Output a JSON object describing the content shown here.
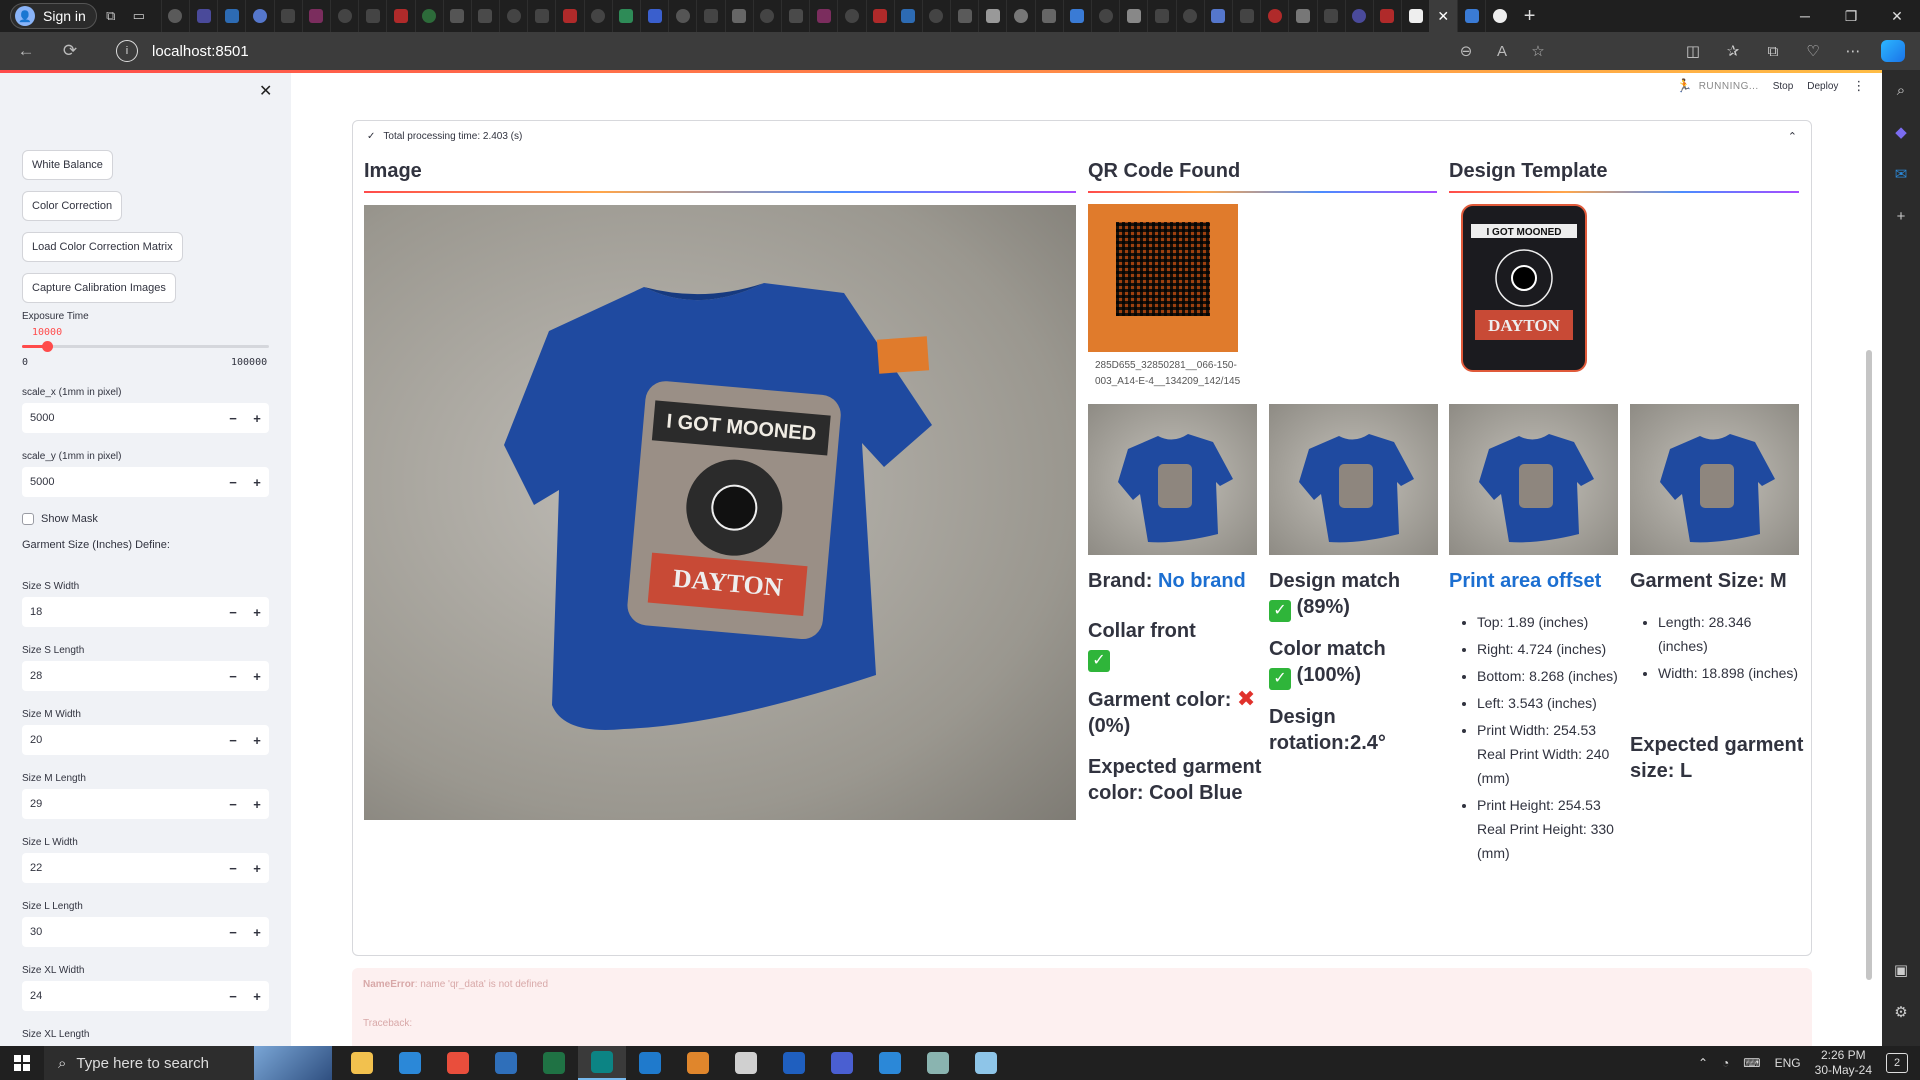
{
  "browser": {
    "signin_label": "Sign in",
    "url": "localhost:8501",
    "tab_colors": [
      "#5a5a5a",
      "#4a4a9a",
      "#2d6bb3",
      "#5577cc",
      "#444",
      "#7b2d5e",
      "#444",
      "#444",
      "#b02a2a",
      "#2d6b3a",
      "#555",
      "#4a4a4a",
      "#444",
      "#444",
      "#b02a2a",
      "#444",
      "#2e8b57",
      "#3a5fcd",
      "#555",
      "#444",
      "#666",
      "#444",
      "#4a4a4a",
      "#7b2d5e",
      "#444",
      "#b02a2a",
      "#2d6bb3",
      "#444",
      "#5a5a5a",
      "#999",
      "#777",
      "#666",
      "#3a7bd5",
      "#444",
      "#888",
      "#444",
      "#444",
      "#5577cc",
      "#444",
      "#b02a2a",
      "#777",
      "#444",
      "#4a4a9a",
      "#b02a2a",
      "#eee",
      "#eee",
      "#5c9f3d",
      "#eee",
      "#3a7bd5"
    ]
  },
  "header": {
    "running_label": "RUNNING...",
    "stop_label": "Stop",
    "deploy_label": "Deploy"
  },
  "sidebar": {
    "buttons": [
      "White Balance",
      "Color Correction",
      "Load Color Correction Matrix",
      "Capture Calibration Images"
    ],
    "exposure": {
      "label": "Exposure Time",
      "value": "10000",
      "min": "0",
      "max": "100000",
      "fraction": 0.1
    },
    "scale_x": {
      "label": "scale_x (1mm in pixel)",
      "value": "5000"
    },
    "scale_y": {
      "label": "scale_y (1mm in pixel)",
      "value": "5000"
    },
    "show_mask_label": "Show Mask",
    "garment_size_heading": "Garment Size (Inches) Define:",
    "sizes": [
      {
        "label": "Size S Width",
        "value": "18"
      },
      {
        "label": "Size S Length",
        "value": "28"
      },
      {
        "label": "Size M Width",
        "value": "20"
      },
      {
        "label": "Size M Length",
        "value": "29"
      },
      {
        "label": "Size L Width",
        "value": "22"
      },
      {
        "label": "Size L Length",
        "value": "30"
      },
      {
        "label": "Size XL Width",
        "value": "24"
      },
      {
        "label": "Size XL Length",
        "value": ""
      }
    ],
    "minus": "−",
    "plus": "+"
  },
  "expander": {
    "title": "Total processing time: 2.403 (s)",
    "col_image": "Image",
    "col_qr": "QR Code Found",
    "col_template": "Design Template",
    "qr_caption": "285D655_32850281__066-150-003_A14-E-4__134209_142/145"
  },
  "results": {
    "brand_label": "Brand: ",
    "brand_value": "No brand",
    "collar_label": "Collar front",
    "garment_color_label": "Garment color:",
    "garment_color_pct": "(0%)",
    "expected_color": "Expected garment color: Cool Blue",
    "design_match_label": "Design match",
    "design_match_pct": "(89%)",
    "color_match_label": "Color match",
    "color_match_pct": "(100%)",
    "design_rotation": "Design rotation:2.4°",
    "print_area_title": "Print area offset",
    "offsets": [
      "Top: 1.89 (inches)",
      "Right: 4.724 (inches)",
      "Bottom: 8.268 (inches)",
      "Left: 3.543 (inches)",
      "Print Width: 254.53 Real Print Width: 240 (mm)",
      "Print Height: 254.53 Real Print Height: 330 (mm)"
    ],
    "garment_size_title": "Garment Size: M",
    "garment_dims": [
      "Length: 28.346 (inches)",
      "Width: 18.898 (inches)"
    ],
    "expected_size": "Expected garment size: L"
  },
  "error": {
    "type": "NameError",
    "message": ": name 'qr_data' is not defined",
    "traceback": "Traceback:"
  },
  "taskbar": {
    "search_placeholder": "Type here to search",
    "apps": [
      "#f2c14e",
      "#2b88d8",
      "#e94e3c",
      "#2f6fba",
      "#1f7244",
      "#0c8484",
      "#1f7acc",
      "#e0862c",
      "#d0d0d0",
      "#1f5fbf",
      "#4a5fd1",
      "#2b88d8",
      "#8ab4b0",
      "#8ec5e8"
    ],
    "time": "2:26 PM",
    "date": "30-May-24",
    "lang": "ENG",
    "notifications": "2"
  },
  "colors": {
    "accent": "#ff4b4b",
    "link": "#1c6fd1",
    "check": "#2fb53a",
    "cross": "#e0312b",
    "shirt": "#1e4a9a"
  }
}
